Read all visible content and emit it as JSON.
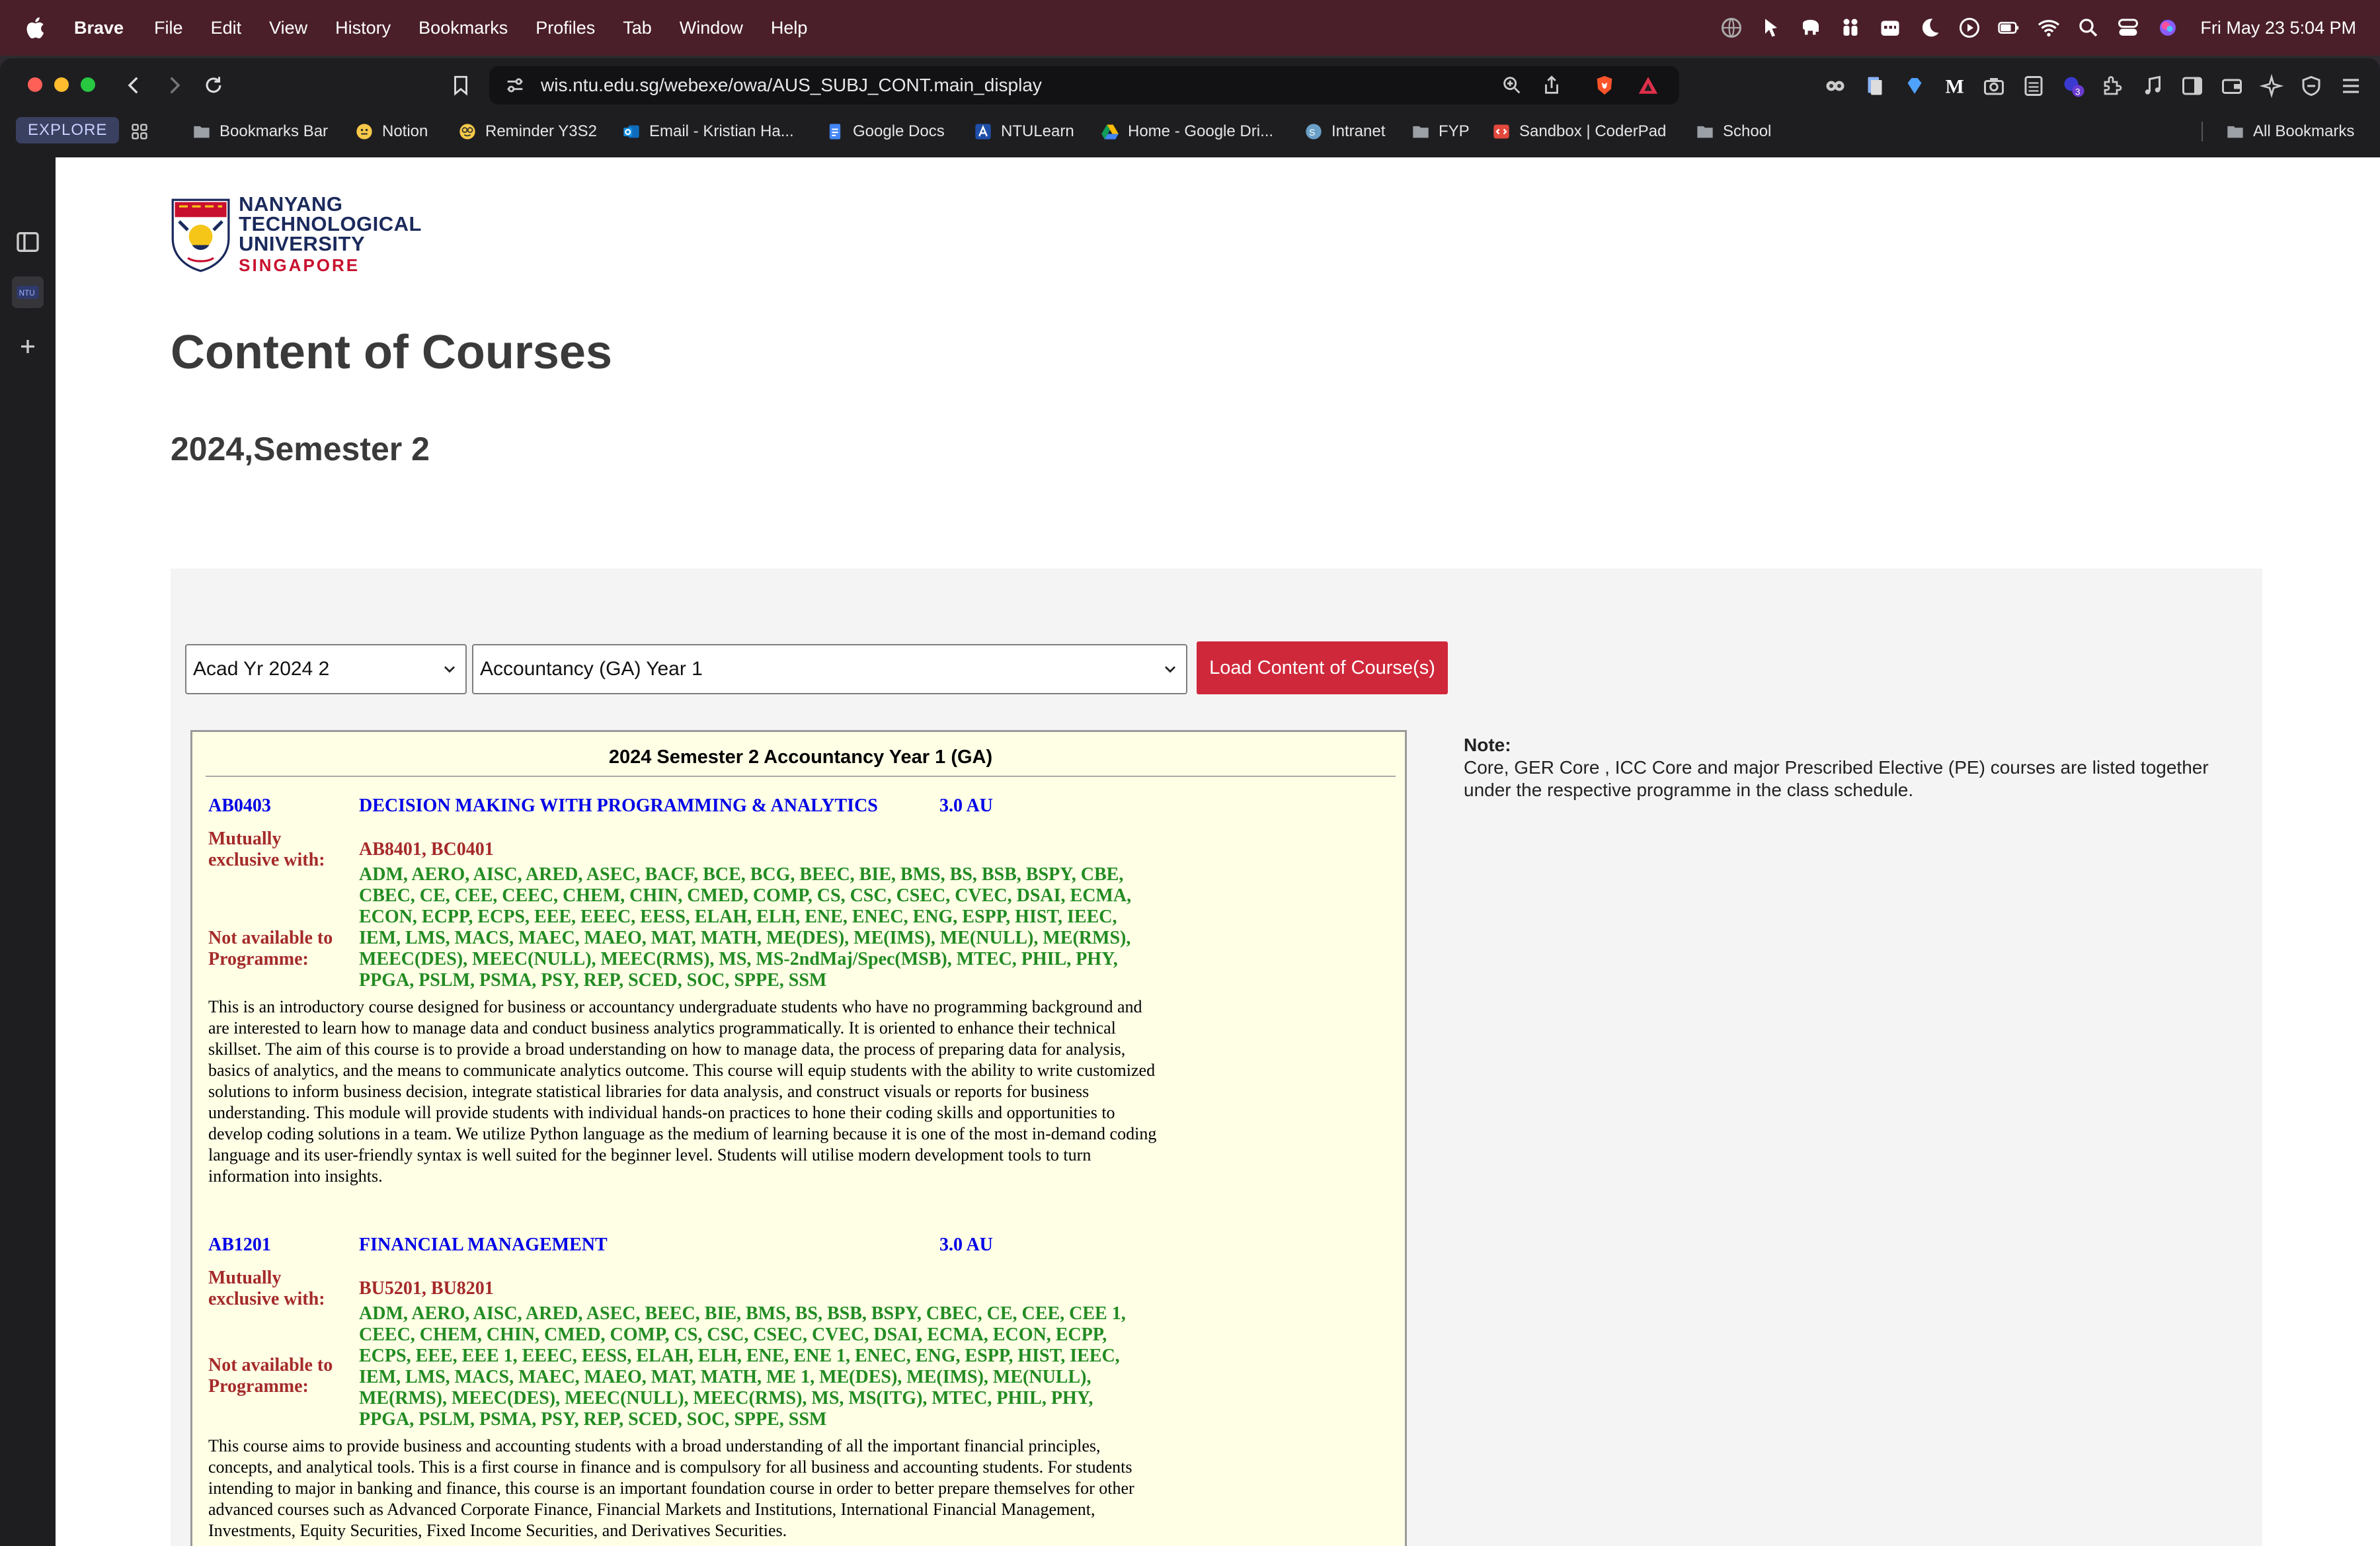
{
  "menubar": {
    "app_name": "Brave",
    "items": [
      "File",
      "Edit",
      "View",
      "History",
      "Bookmarks",
      "Profiles",
      "Tab",
      "Window",
      "Help"
    ],
    "clock": "Fri May 23  5:04 PM"
  },
  "browser": {
    "url": "wis.ntu.edu.sg/webexe/owa/AUS_SUBJ_CONT.main_display",
    "explore_label": "EXPLORE",
    "bookmarks": [
      "Bookmarks Bar",
      "Notion",
      "Reminder Y3S2",
      "Email - Kristian Ha...",
      "Google Docs",
      "NTULearn",
      "Home - Google Dri...",
      "Intranet",
      "FYP",
      "Sandbox | CoderPad",
      "School"
    ],
    "all_bookmarks": "All Bookmarks",
    "sidebar_tab_label": "NTU",
    "extension_badge": "3"
  },
  "page": {
    "logo": {
      "line1": "NANYANG",
      "line2": "TECHNOLOGICAL",
      "line3": "UNIVERSITY",
      "line4": "SINGAPORE"
    },
    "title": "Content of Courses",
    "semester": "2024,Semester 2",
    "year_select": "Acad Yr 2024 2",
    "programme_select": "Accountancy (GA) Year 1",
    "load_button": "Load Content of Course(s)",
    "box_heading": "2024 Semester 2 Accountancy Year 1 (GA)",
    "labels": {
      "mutex_1": "Mutually",
      "mutex_2": "exclusive with:",
      "na_1": "Not available to",
      "na_2": "Programme:"
    },
    "note_title": "Note:",
    "note_text": "Core, GER Core , ICC Core and major Prescribed Elective (PE) courses are listed together under the respective programme in the class schedule."
  },
  "courses": [
    {
      "code": "AB0403",
      "title": "DECISION MAKING WITH PROGRAMMING & ANALYTICS",
      "au": "3.0 AU",
      "mutex": "AB8401, BC0401",
      "not_available": "ADM, AERO, AISC, ARED, ASEC, BACF, BCE, BCG, BEEC, BIE, BMS, BS, BSB, BSPY, CBE, CBEC, CE, CEE, CEEC, CHEM, CHIN, CMED, COMP, CS, CSC, CSEC, CVEC, DSAI, ECMA, ECON, ECPP, ECPS, EEE, EEEC, EESS, ELAH, ELH, ENE, ENEC, ENG, ESPP, HIST, IEEC, IEM, LMS, MACS, MAEC, MAEO, MAT, MATH, ME(DES), ME(IMS), ME(NULL), ME(RMS), MEEC(DES), MEEC(NULL), MEEC(RMS), MS, MS-2ndMaj/Spec(MSB), MTEC, PHIL, PHY, PPGA, PSLM, PSMA, PSY, REP, SCED, SOC, SPPE, SSM",
      "description": "This is an introductory course designed for business or accountancy undergraduate students who have no programming background and are interested to learn how to manage data and conduct business analytics programmatically. It is oriented to enhance their technical skillset. The aim of this course is to provide a broad understanding on how to manage data, the process of preparing data for analysis, basics of analytics, and the means to communicate analytics outcome. This course will equip students with the ability to write customized solutions to inform business decision, integrate statistical libraries for data analysis, and construct visuals or reports for business understanding. This module will provide students with individual hands-on practices to hone their coding skills and opportunities to develop coding solutions in a team. We utilize Python language as the medium of learning because it is one of the most in-demand coding language and its user-friendly syntax is well suited for the beginner level. Students will utilise modern development tools to turn information into insights."
    },
    {
      "code": "AB1201",
      "title": "FINANCIAL MANAGEMENT",
      "au": "3.0 AU",
      "mutex": "BU5201, BU8201",
      "not_available": "ADM, AERO, AISC, ARED, ASEC, BEEC, BIE, BMS, BS, BSB, BSPY, CBEC, CE, CEE, CEE 1, CEEC, CHEM, CHIN, CMED, COMP, CS, CSC, CSEC, CVEC, DSAI, ECMA, ECON, ECPP, ECPS, EEE, EEE 1, EEEC, EESS, ELAH, ELH, ENE, ENE 1, ENEC, ENG, ESPP, HIST, IEEC, IEM, LMS, MACS, MAEC, MAEO, MAT, MATH, ME 1, ME(DES), ME(IMS), ME(NULL), ME(RMS), MEEC(DES), MEEC(NULL), MEEC(RMS), MS, MS(ITG), MTEC, PHIL, PHY, PPGA, PSLM, PSMA, PSY, REP, SCED, SOC, SPPE, SSM",
      "description": "This course aims to provide business and accounting students with a broad understanding of all the important financial principles, concepts, and analytical tools. This is a first course in finance and is compulsory for all business and accounting students. For students intending to major in banking and finance, this course is an important foundation course in order to better prepare themselves for other advanced courses such as Advanced Corporate Finance, Financial Markets and Institutions, International Financial Management, Investments, Equity Securities, Fixed Income Securities, and Derivatives Securities."
    }
  ]
}
